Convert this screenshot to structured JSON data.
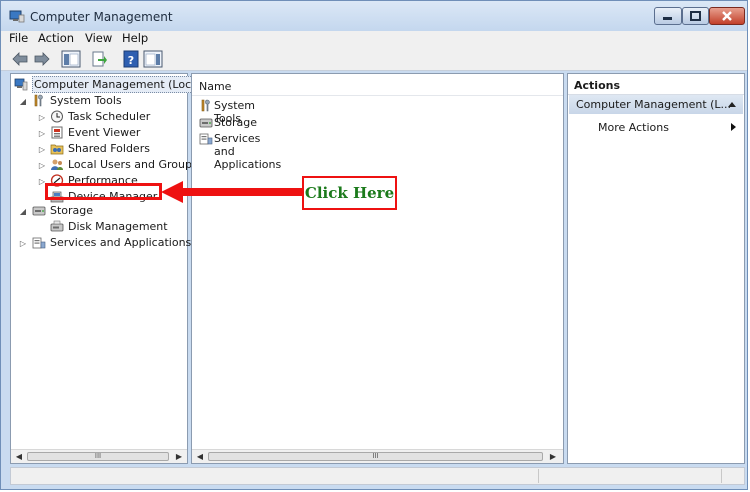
{
  "window": {
    "title": "Computer Management"
  },
  "menu": [
    "File",
    "Action",
    "View",
    "Help"
  ],
  "tree": {
    "root": "Computer Management (Local",
    "system_tools": "System Tools",
    "task_scheduler": "Task Scheduler",
    "event_viewer": "Event Viewer",
    "shared_folders": "Shared Folders",
    "local_users": "Local Users and Groups",
    "performance": "Performance",
    "device_manager": "Device Manager",
    "storage": "Storage",
    "disk_management": "Disk Management",
    "services": "Services and Applications"
  },
  "middle": {
    "column_header": "Name",
    "rows": [
      "System Tools",
      "Storage",
      "Services and Applications"
    ]
  },
  "actions": {
    "title": "Actions",
    "section": "Computer Management (L...",
    "more": "More Actions"
  },
  "scroll_thumb": "III",
  "annotation": {
    "callout": "Click Here",
    "color": "#ee1111",
    "text_color": "#1b7a1b"
  },
  "colors": {
    "frame": "#c9dbf0",
    "accent": "#ee1111"
  }
}
